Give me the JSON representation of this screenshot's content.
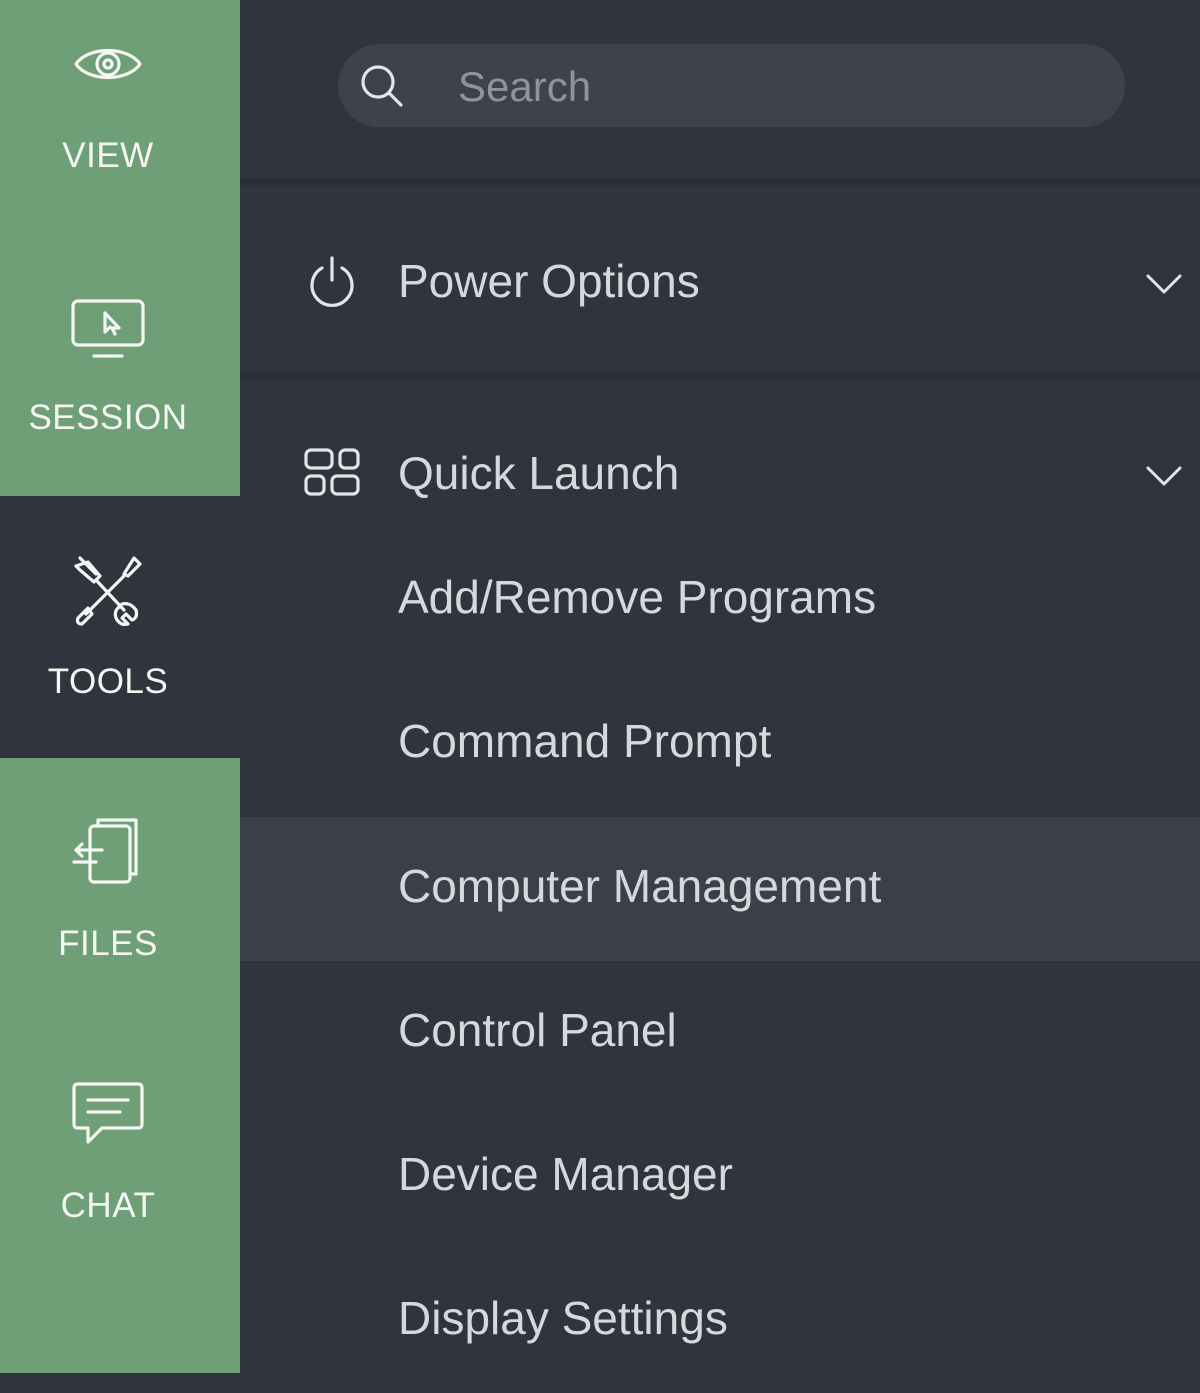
{
  "colors": {
    "rail_green": "#6f9f76",
    "panel_bg": "#30343c",
    "search_bg": "#3e424a",
    "hover_bg": "#3b3f47",
    "text": "#d5d8dc"
  },
  "rail": {
    "items": [
      {
        "label": "VIEW",
        "icon": "eye-icon"
      },
      {
        "label": "SESSION",
        "icon": "monitor-cursor-icon"
      },
      {
        "label": "TOOLS",
        "icon": "tools-icon",
        "active": true
      },
      {
        "label": "FILES",
        "icon": "file-transfer-icon"
      },
      {
        "label": "CHAT",
        "icon": "chat-bubble-icon"
      }
    ]
  },
  "search": {
    "placeholder": "Search",
    "icon": "search-icon"
  },
  "sections": [
    {
      "label": "Power Options",
      "icon": "power-icon",
      "chevron": "chevron-down-icon"
    },
    {
      "label": "Quick Launch",
      "icon": "grid-icon",
      "chevron": "chevron-down-icon",
      "items": [
        "Add/Remove Programs",
        "Command Prompt",
        "Computer Management",
        "Control Panel",
        "Device Manager",
        "Display Settings"
      ],
      "highlighted_item": "Computer Management"
    }
  ]
}
